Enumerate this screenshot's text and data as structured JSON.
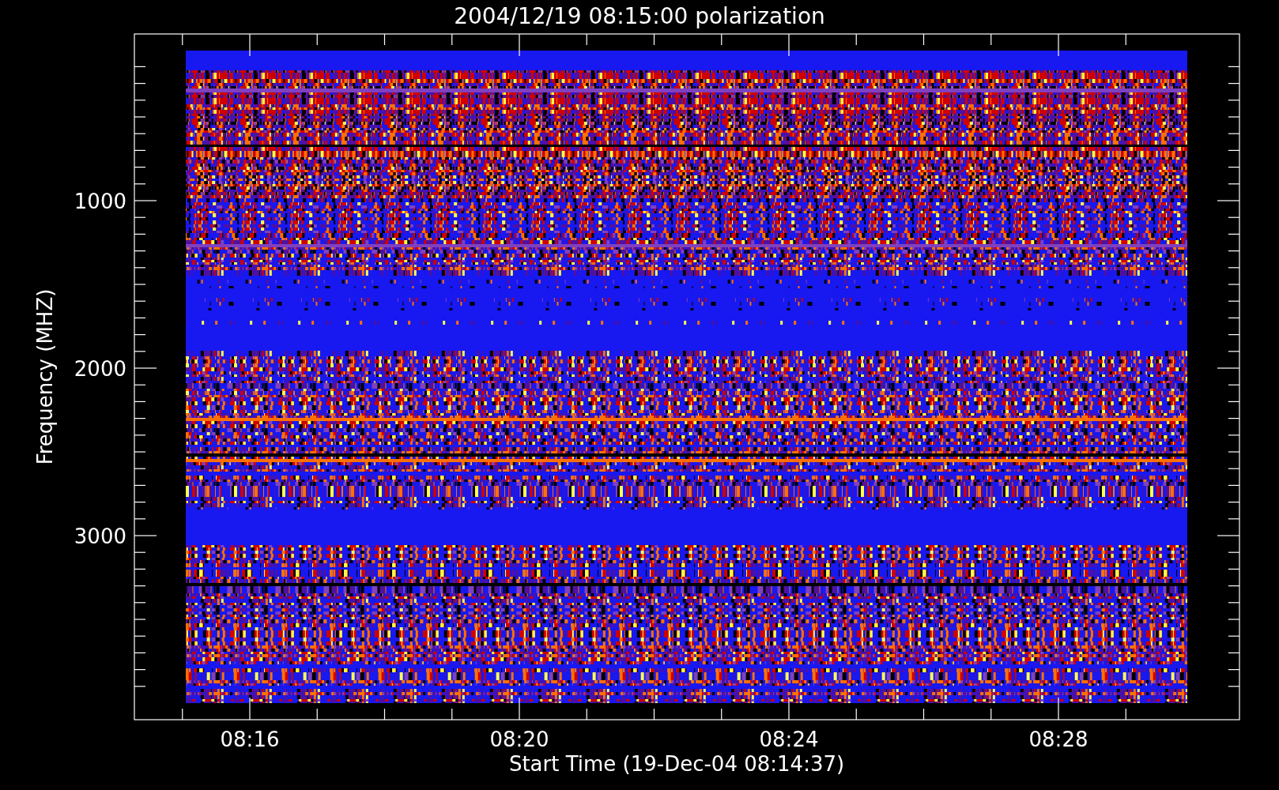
{
  "plot": {
    "title": "2004/12/19 08:15:00 polarization",
    "xlabel": "Start Time (19-Dec-04 08:14:37)",
    "ylabel": "Frequency (MHZ)",
    "x_tick_labels": [
      "08:16",
      "08:20",
      "08:24",
      "08:28"
    ],
    "y_tick_labels": [
      "1000",
      "2000",
      "3000"
    ]
  }
}
